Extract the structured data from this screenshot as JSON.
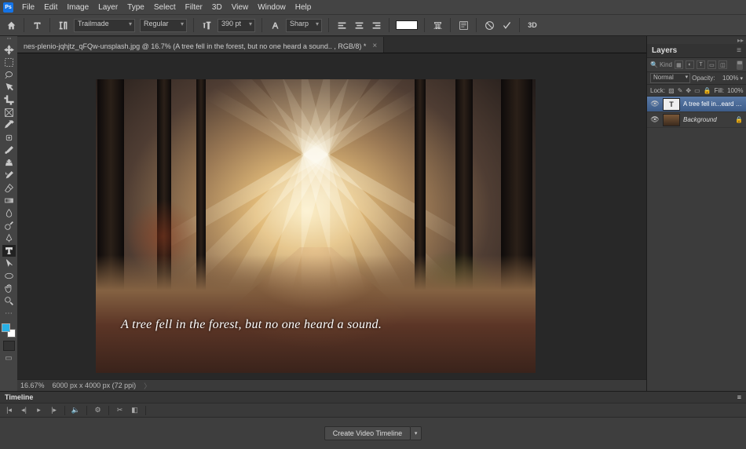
{
  "menu": {
    "logo": "Ps",
    "items": [
      "File",
      "Edit",
      "Image",
      "Layer",
      "Type",
      "Select",
      "Filter",
      "3D",
      "View",
      "Window",
      "Help"
    ]
  },
  "options": {
    "font_family": "Trailmade",
    "font_style": "Regular",
    "font_size": "390 pt",
    "antialias_label": "Sharp",
    "text_color": "#ffffff"
  },
  "document": {
    "tab_title": "nes-plenio-jqhjtz_qFQw-unsplash.jpg @ 16.7% (A tree fell in the forest, but no one heard a sound.. , RGB/8) *",
    "caption_text": "A tree fell in the forest, but no one heard a sound."
  },
  "status": {
    "zoom": "16.67%",
    "info": "6000 px x 4000 px (72 ppi)"
  },
  "layers_panel": {
    "title": "Layers",
    "filter_kind": "Kind",
    "blend_mode": "Normal",
    "opacity_label": "Opacity:",
    "opacity_value": "100%",
    "lock_label": "Lock:",
    "fill_label": "Fill:",
    "fill_value": "100%",
    "layers": [
      {
        "name": "A tree fell in...eard a sound.",
        "type": "text",
        "visible": true,
        "selected": true,
        "locked": false
      },
      {
        "name": "Background",
        "type": "image",
        "visible": true,
        "selected": false,
        "locked": true
      }
    ]
  },
  "timeline": {
    "title": "Timeline",
    "create_button": "Create Video Timeline"
  }
}
